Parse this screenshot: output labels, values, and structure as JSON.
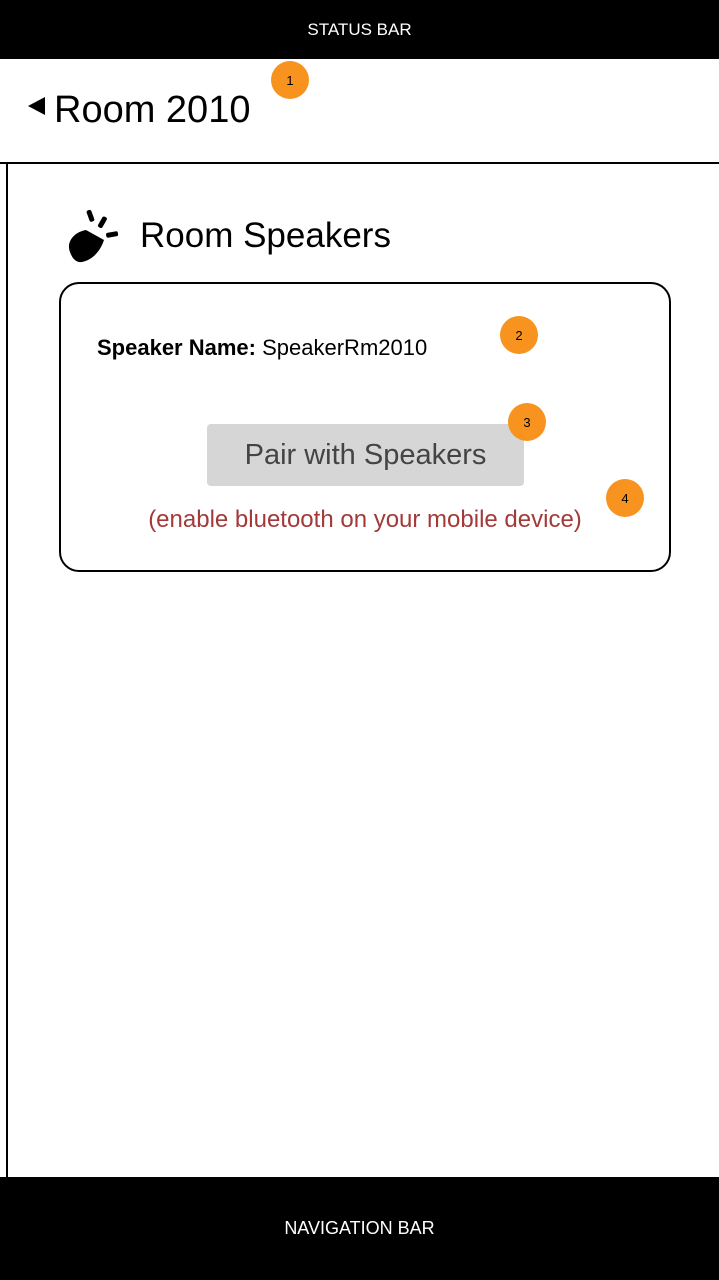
{
  "status_bar": {
    "label": "STATUS BAR"
  },
  "header": {
    "back_icon": "back-triangle-icon",
    "title": "Room 2010"
  },
  "section": {
    "icon": "speaker-icon",
    "title": "Room Speakers"
  },
  "speaker_card": {
    "name_label": "Speaker Name:",
    "name_value": "SpeakerRm2010",
    "pair_button_label": "Pair with Speakers",
    "bluetooth_note": "(enable bluetooth on your mobile device)"
  },
  "nav_bar": {
    "label": "NAVIGATION BAR"
  },
  "annotations": {
    "badge_1": "1",
    "badge_2": "2",
    "badge_3": "3",
    "badge_4": "4"
  },
  "colors": {
    "badge": "#f7931e",
    "note": "#a33a3a",
    "button_bg": "#d6d6d6",
    "bars": "#000000"
  }
}
